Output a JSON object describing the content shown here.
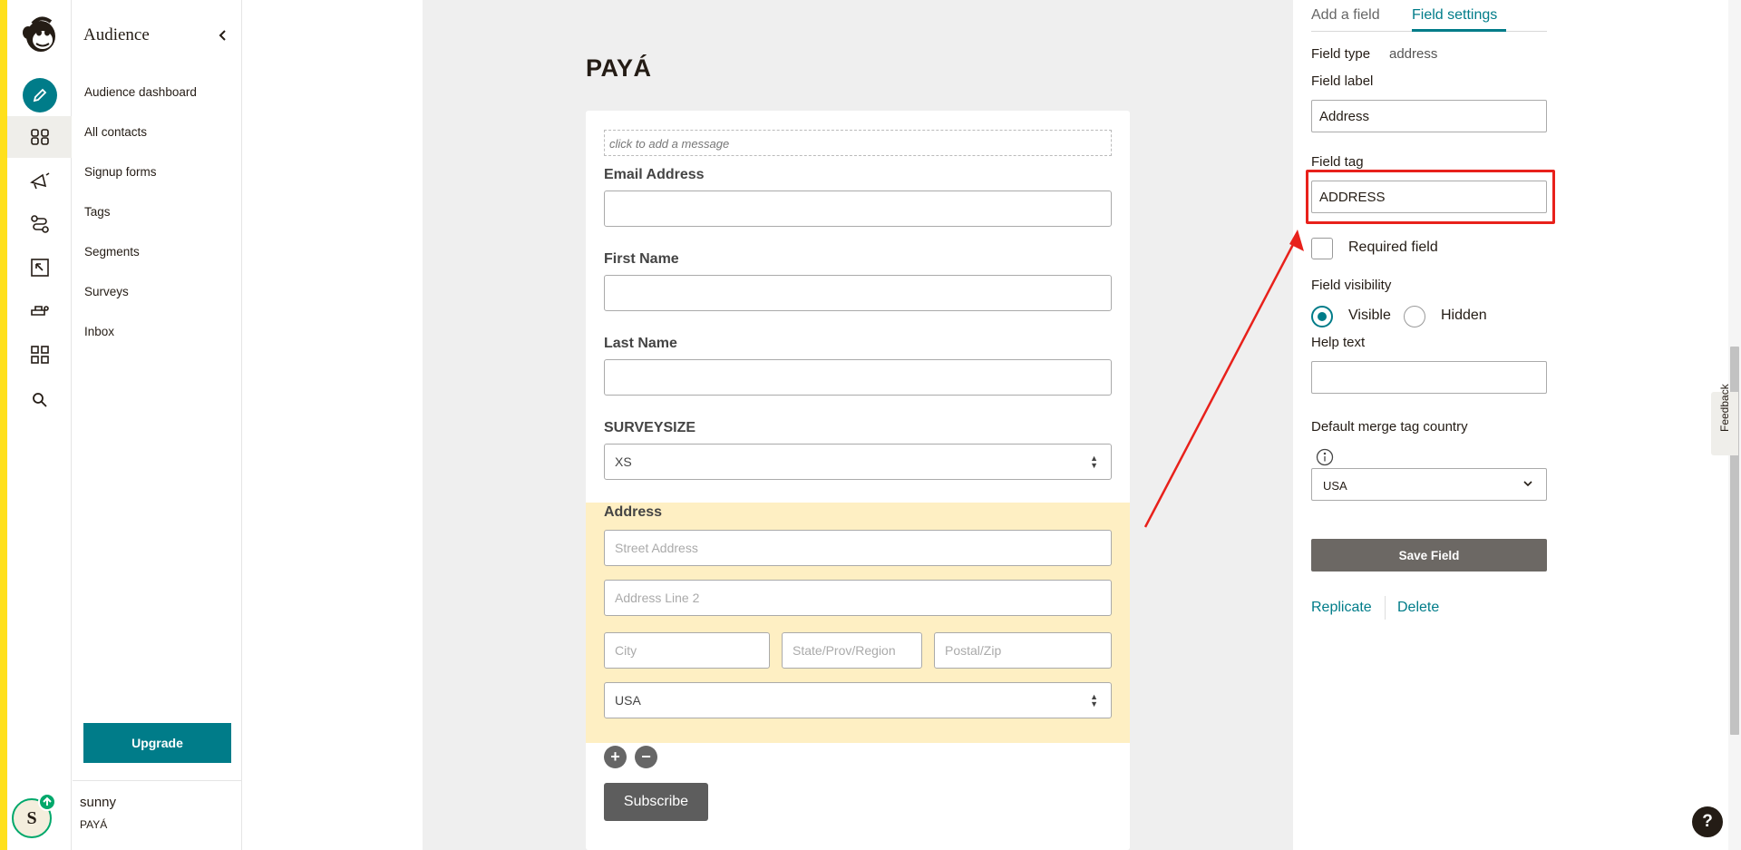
{
  "nav": {
    "title": "Audience",
    "items": [
      "Audience dashboard",
      "All contacts",
      "Signup forms",
      "Tags",
      "Segments",
      "Surveys",
      "Inbox"
    ],
    "upgrade": "Upgrade",
    "user_name": "sunny",
    "user_org": "PAYÁ",
    "avatar_initial": "S"
  },
  "form": {
    "title": "PAYÁ",
    "message_placeholder": "click to add a message",
    "email_label": "Email Address",
    "first_name_label": "First Name",
    "last_name_label": "Last Name",
    "survey_label": "SURVEYSIZE",
    "survey_value": "XS",
    "address_label": "Address",
    "street_placeholder": "Street Address",
    "line2_placeholder": "Address Line 2",
    "city_placeholder": "City",
    "state_placeholder": "State/Prov/Region",
    "zip_placeholder": "Postal/Zip",
    "country_value": "USA",
    "subscribe": "Subscribe"
  },
  "settings": {
    "tab_add": "Add a field",
    "tab_settings": "Field settings",
    "field_type_label": "Field type",
    "field_type_value": "address",
    "field_label_label": "Field label",
    "field_label_value": "Address",
    "field_tag_label": "Field tag",
    "field_tag_value": "ADDRESS",
    "required_label": "Required field",
    "visibility_label": "Field visibility",
    "visible": "Visible",
    "hidden": "Hidden",
    "help_text_label": "Help text",
    "merge_country_label": "Default merge tag country",
    "merge_country_value": "USA",
    "save": "Save Field",
    "replicate": "Replicate",
    "delete": "Delete"
  },
  "feedback": "Feedback",
  "help": "?",
  "colors": {
    "accent": "#007c89",
    "highlight": "#e8211b",
    "brand_yellow": "#ffe01b"
  }
}
